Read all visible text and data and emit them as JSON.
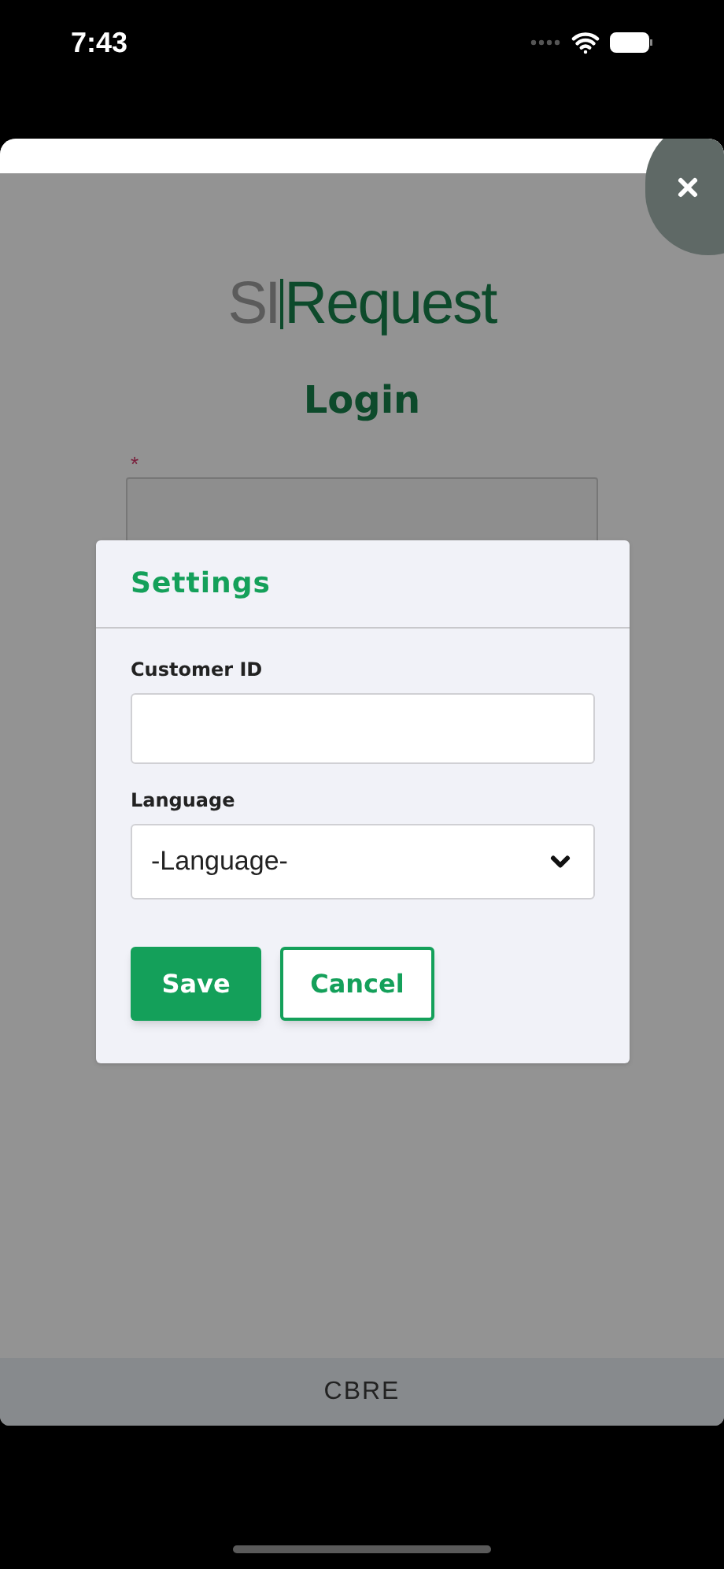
{
  "status_bar": {
    "time": "7:43"
  },
  "login_page": {
    "logo": {
      "prefix": "SI",
      "name": "Request"
    },
    "title": "Login",
    "required_mark": "*"
  },
  "settings_dialog": {
    "title": "Settings",
    "fields": [
      {
        "kind": "text",
        "label": "Customer ID"
      },
      {
        "kind": "select",
        "label": "Language",
        "value": "-Language-"
      }
    ],
    "buttons": [
      {
        "kind": "primary",
        "label": "Save"
      },
      {
        "kind": "secondary",
        "label": "Cancel"
      }
    ]
  },
  "footer": {
    "label": "CBRE"
  }
}
